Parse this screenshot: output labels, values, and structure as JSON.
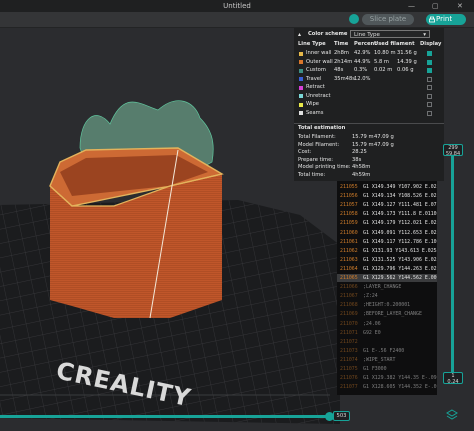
{
  "window": {
    "title": "Untitled",
    "min_glyph": "—",
    "max_glyph": "▢",
    "close_glyph": "✕"
  },
  "toolbar": {
    "slice_plate": "Slice plate",
    "print": "Print"
  },
  "legend": {
    "color_scheme_label": "Color scheme",
    "color_scheme_value": "Line Type",
    "headers": [
      "Line Type",
      "Time",
      "Percent",
      "Used filament",
      "Display"
    ],
    "rows": [
      {
        "name": "Inner wall",
        "time": "2h8m",
        "percent": "42.9%",
        "length": "10.80 m",
        "weight": "31.56 g",
        "color": "#e6b84a",
        "display": true
      },
      {
        "name": "Outer wall",
        "time": "2h14m",
        "percent": "44.9%",
        "length": "5.8 m",
        "weight": "14.39 g",
        "color": "#d9762b",
        "display": true
      },
      {
        "name": "Custom",
        "time": "48s",
        "percent": "0.3%",
        "length": "0.02 m",
        "weight": "0.06 g",
        "color": "#3c8f83",
        "display": true
      },
      {
        "name": "Travel",
        "time": "35m48s",
        "percent": "12.0%",
        "length": "",
        "weight": "",
        "color": "#3a5fd6",
        "display": false
      },
      {
        "name": "Retract",
        "time": "",
        "percent": "",
        "length": "",
        "weight": "",
        "color": "#d640d6",
        "display": false
      },
      {
        "name": "Unretract",
        "time": "",
        "percent": "",
        "length": "",
        "weight": "",
        "color": "#7ad6d6",
        "display": false
      },
      {
        "name": "Wipe",
        "time": "",
        "percent": "",
        "length": "",
        "weight": "",
        "color": "#e8e84a",
        "display": false
      },
      {
        "name": "Seams",
        "time": "",
        "percent": "",
        "length": "",
        "weight": "",
        "color": "#e0e0e0",
        "display": false
      }
    ],
    "total_title": "Total estimation",
    "totals": [
      {
        "label": "Total Filament:",
        "value": "15.79 m",
        "extra": "47.09 g"
      },
      {
        "label": "Model Filament:",
        "value": "15.79 m",
        "extra": "47.09 g"
      },
      {
        "label": "Cost:",
        "value": "28.25",
        "extra": ""
      },
      {
        "label": "Prepare time:",
        "value": "38s",
        "extra": ""
      },
      {
        "label": "Model printing time:",
        "value": "4h58m",
        "extra": ""
      },
      {
        "label": "Total time:",
        "value": "4h59m",
        "extra": ""
      }
    ]
  },
  "gcode": [
    {
      "line": "211055",
      "cmd": "G1 X149.349 Y107.902 E.0253"
    },
    {
      "line": "211056",
      "cmd": "G1 X149.134 Y108.526 E.02107"
    },
    {
      "line": "211057",
      "cmd": "G1 X149.127 Y111.481 E.0753"
    },
    {
      "line": "211058",
      "cmd": "G1 X149.173 Y111.8 E.01103"
    },
    {
      "line": "211059",
      "cmd": "G1 X149.179 Y112.021 E.0253"
    },
    {
      "line": "211060",
      "cmd": "G1 X149.091 Y112.653 E.0253"
    },
    {
      "line": "211061",
      "cmd": "G1 X149.117 Y112.786 E.10341"
    },
    {
      "line": "211062",
      "cmd": "G1 X131.93 Y143.613 E.0253"
    },
    {
      "line": "211063",
      "cmd": "G1 X131.525 Y143.906 E.0253"
    },
    {
      "line": "211064",
      "cmd": "G1 X129.796 Y144.263 E.02728"
    },
    {
      "line": "211065",
      "cmd": "G1 X129.562 Y144.562 E.00946"
    },
    {
      "line": "211066",
      "cmd": ";LAYER_CHANGE"
    },
    {
      "line": "211067",
      "cmd": ";Z:24"
    },
    {
      "line": "211068",
      "cmd": ";HEIGHT:0.200001"
    },
    {
      "line": "211069",
      "cmd": ";BEFORE_LAYER_CHANGE"
    },
    {
      "line": "211070",
      "cmd": ";24.06"
    },
    {
      "line": "211071",
      "cmd": "G92 E0"
    },
    {
      "line": "211072",
      "cmd": ""
    },
    {
      "line": "211073",
      "cmd": "G1 E-.56 F2400"
    },
    {
      "line": "211074",
      "cmd": ";WIPE_START"
    },
    {
      "line": "211075",
      "cmd": "G1 F3000"
    },
    {
      "line": "211076",
      "cmd": "G1 X129.382 Y144.35 E-.099"
    },
    {
      "line": "211077",
      "cmd": "G1 X128.605 Y144.352 E-.0253"
    }
  ],
  "layer_slider": {
    "top_value": "299",
    "top_height": "59.84",
    "bottom_value": "1",
    "bottom_height": "0.24"
  },
  "move_slider": {
    "value": "503"
  },
  "bed": {
    "brand": "CREALITY"
  },
  "colors": {
    "accent": "#17a398",
    "model": "#c0562a",
    "ghost": "#8fe0bb",
    "bed": "#1b1c1e"
  }
}
